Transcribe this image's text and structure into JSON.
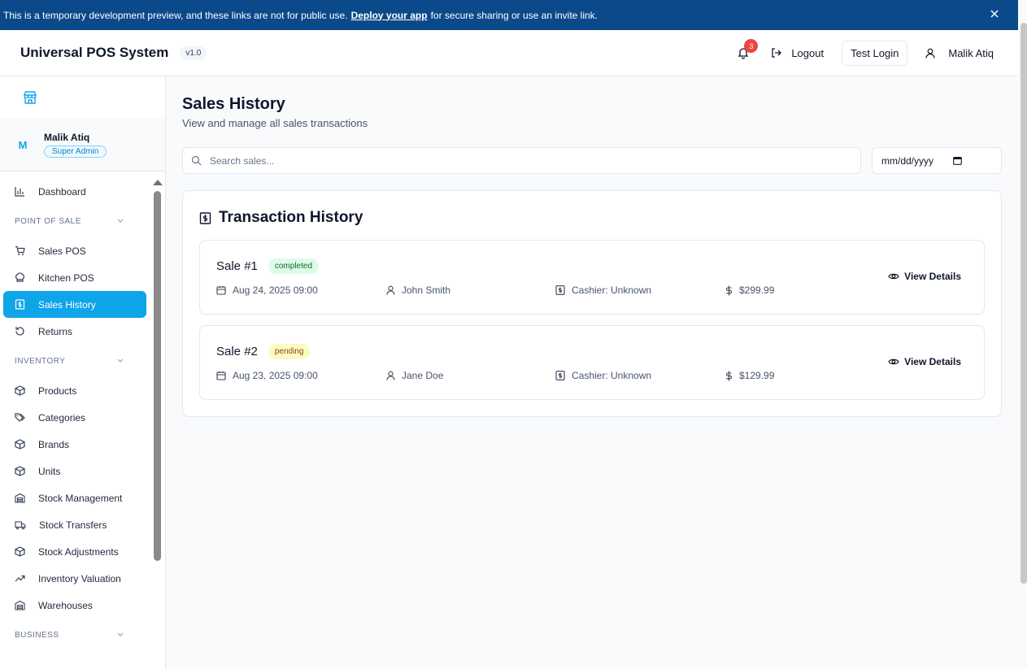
{
  "banner": {
    "text_before": "This is a temporary development preview, and these links are not for public use.",
    "link": "Deploy your app",
    "text_after": "for secure sharing or use an invite link."
  },
  "header": {
    "app_title": "Universal POS System",
    "version": "v1.0",
    "notification_count": "3",
    "logout": "Logout",
    "test_login": "Test Login",
    "user_name": "Malik Atiq"
  },
  "sidebar": {
    "profile": {
      "initial": "M",
      "name": "Malik Atiq",
      "role": "Super Admin"
    },
    "items": {
      "dashboard": "Dashboard",
      "sales_pos": "Sales POS",
      "kitchen_pos": "Kitchen POS",
      "sales_history": "Sales History",
      "returns": "Returns",
      "products": "Products",
      "categories": "Categories",
      "brands": "Brands",
      "units": "Units",
      "stock_management": "Stock Management",
      "stock_transfers": "Stock Transfers",
      "stock_adjustments": "Stock Adjustments",
      "inventory_valuation": "Inventory Valuation",
      "warehouses": "Warehouses"
    },
    "sections": {
      "pos": "POINT OF SALE",
      "inventory": "INVENTORY",
      "business": "BUSINESS"
    }
  },
  "main": {
    "title": "Sales History",
    "subtitle": "View and manage all sales transactions",
    "search_placeholder": "Search sales...",
    "date_placeholder": "mm/dd/yyyy",
    "card_title": "Transaction History",
    "view_details": "View Details",
    "sales": [
      {
        "name": "Sale #1",
        "status": "completed",
        "date": "Aug 24, 2025 09:00",
        "customer": "John Smith",
        "cashier": "Cashier: Unknown",
        "amount": "$299.99"
      },
      {
        "name": "Sale #2",
        "status": "pending",
        "date": "Aug 23, 2025 09:00",
        "customer": "Jane Doe",
        "cashier": "Cashier: Unknown",
        "amount": "$129.99"
      }
    ]
  },
  "colors": {
    "banner": "#0b4a8a",
    "accent": "#0ea5e9",
    "badge": "#ef4444"
  }
}
